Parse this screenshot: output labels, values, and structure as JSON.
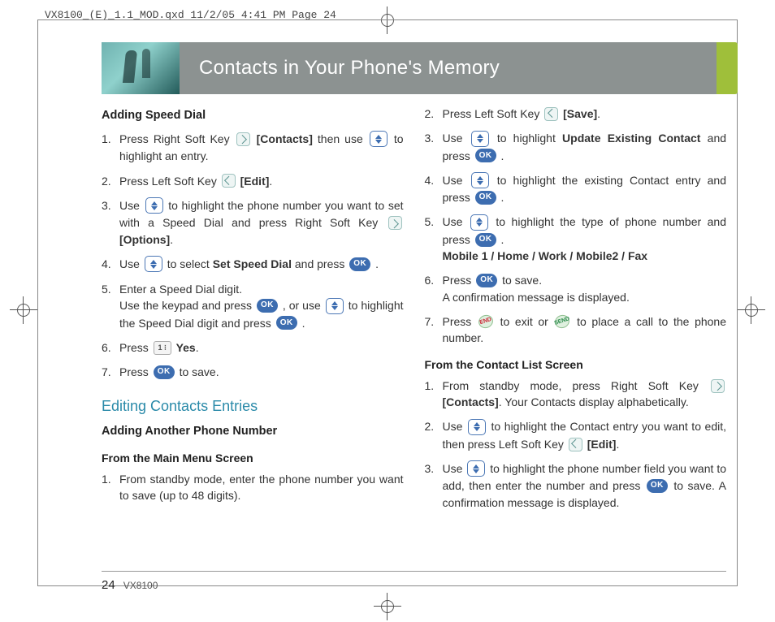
{
  "crop_header": "VX8100_(E)_1.1_MOD.qxd  11/2/05  4:41 PM  Page 24",
  "banner_title": "Contacts in Your Phone's Memory",
  "footer": {
    "page": "24",
    "model": "VX8100"
  },
  "icons": {
    "softRight": "right-soft-key",
    "softLeft": "left-soft-key",
    "nav": "navigation-key",
    "ok": "OK",
    "key1": "1 ⁝",
    "end": "END",
    "send": "SEND"
  },
  "left": {
    "h1": "Adding Speed Dial",
    "items": [
      {
        "n": "1.",
        "a": "Press Right Soft Key ",
        "b": "[Contacts]",
        "c": " then use ",
        "d": " to highlight an entry."
      },
      {
        "n": "2.",
        "a": "Press Left Soft Key ",
        "b": "[Edit]",
        "c": "."
      },
      {
        "n": "3.",
        "a": "Use ",
        "b": " to highlight the phone number you want to set with a Speed Dial and press Right Soft Key ",
        "c": "[Options]",
        "d": "."
      },
      {
        "n": "4.",
        "a": "Use ",
        "b": " to select ",
        "c": "Set Speed Dial",
        "d": " and press ",
        "e": " ."
      },
      {
        "n": "5.",
        "a": "Enter a Speed Dial digit.",
        "b": "Use the keypad and press ",
        "c": " , or use ",
        "d": " to highlight the Speed Dial digit and press ",
        "e": " ."
      },
      {
        "n": "6.",
        "a": "Press ",
        "b": "Yes",
        "c": "."
      },
      {
        "n": "7.",
        "a": "Press ",
        "b": " to save."
      }
    ],
    "h2": "Editing Contacts Entries",
    "h3": "Adding Another Phone Number",
    "h4": "From the Main Menu Screen",
    "main1": {
      "n": "1.",
      "a": "From standby mode, enter the phone number you want to save (up to 48 digits)."
    }
  },
  "right": {
    "top": [
      {
        "n": "2.",
        "a": "Press Left Soft Key ",
        "b": "[Save]",
        "c": "."
      },
      {
        "n": "3.",
        "a": "Use ",
        "b": " to highlight ",
        "c": "Update Existing Contact",
        "d": " and press ",
        "e": " ."
      },
      {
        "n": "4.",
        "a": "Use ",
        "b": " to highlight the existing Contact entry and press ",
        "c": " ."
      },
      {
        "n": "5.",
        "a": "Use ",
        "b": " to highlight the type of phone number and press ",
        "c": " .",
        "d": "Mobile 1 / Home / Work / Mobile2 / Fax"
      },
      {
        "n": "6.",
        "a": "Press ",
        "b": " to save.",
        "c": "A confirmation message is displayed."
      },
      {
        "n": "7.",
        "a": "Press ",
        "b": " to exit or ",
        "c": " to place a call to the phone number."
      }
    ],
    "h1": "From the Contact List Screen",
    "list": [
      {
        "n": "1.",
        "a": "From standby mode, press Right Soft Key ",
        "b": "[Contacts]",
        "c": ". Your Contacts display alphabetically."
      },
      {
        "n": "2.",
        "a": "Use ",
        "b": " to highlight the Contact entry you want to edit, then press Left Soft Key ",
        "c": "[Edit]",
        "d": "."
      },
      {
        "n": "3.",
        "a": "Use ",
        "b": " to highlight the phone number field you want to add, then enter the number and press ",
        "c": " to save. A confirmation message is displayed."
      }
    ]
  }
}
